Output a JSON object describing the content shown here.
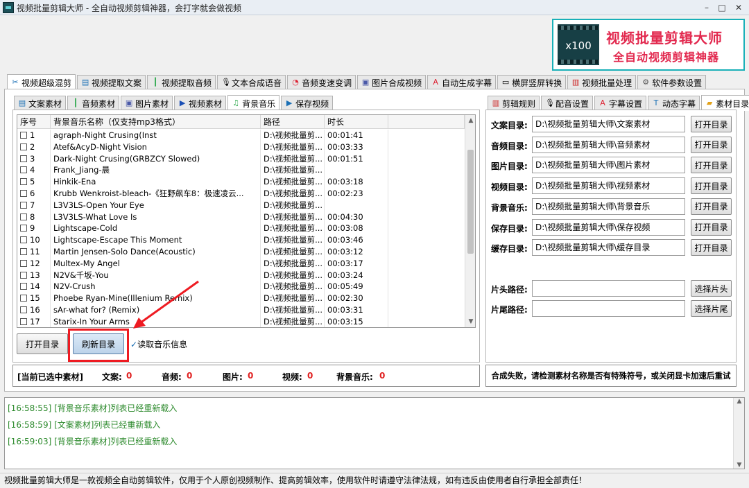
{
  "window": {
    "title": "视频批量剪辑大师 - 全自动视频剪辑神器，会打字就会做视频",
    "min": "–",
    "max": "□",
    "close": "✕"
  },
  "logo": {
    "badge": "x100",
    "title": "视频批量剪辑大师",
    "subtitle": "全自动视频剪辑神器"
  },
  "main_tabs": [
    {
      "label": "视频超级混剪",
      "icon": "scissors-icon"
    },
    {
      "label": "视频提取文案",
      "icon": "document-icon"
    },
    {
      "label": "视频提取音频",
      "icon": "waveform-icon"
    },
    {
      "label": "文本合成语音",
      "icon": "microphone-icon"
    },
    {
      "label": "音频变速变调",
      "icon": "gauge-icon"
    },
    {
      "label": "图片合成视频",
      "icon": "image-icon"
    },
    {
      "label": "自动生成字幕",
      "icon": "subtitle-icon"
    },
    {
      "label": "横屏竖屏转换",
      "icon": "rotate-screen-icon"
    },
    {
      "label": "视频批量处理",
      "icon": "film-icon"
    },
    {
      "label": "软件参数设置",
      "icon": "gear-icon"
    }
  ],
  "left_tabs": [
    {
      "label": "文案素材"
    },
    {
      "label": "音频素材"
    },
    {
      "label": "图片素材"
    },
    {
      "label": "视频素材"
    },
    {
      "label": "背景音乐"
    },
    {
      "label": "保存视频"
    }
  ],
  "right_tabs": [
    {
      "label": "剪辑规则"
    },
    {
      "label": "配音设置"
    },
    {
      "label": "字幕设置"
    },
    {
      "label": "动态字幕"
    },
    {
      "label": "素材目录"
    }
  ],
  "table": {
    "headers": [
      "序号",
      "背景音乐名称（仅支持mp3格式）",
      "路径",
      "时长"
    ],
    "rows": [
      {
        "no": "1",
        "name": "agraph-Night Crusing(Inst",
        "path": "D:\\视频批量剪...",
        "dur": "00:01:41"
      },
      {
        "no": "2",
        "name": "Atef&AcyD-Night Vision",
        "path": "D:\\视频批量剪...",
        "dur": "00:03:33"
      },
      {
        "no": "3",
        "name": "Dark-Night Crusing(GRBZCY Slowed)",
        "path": "D:\\视频批量剪...",
        "dur": "00:01:51"
      },
      {
        "no": "4",
        "name": "Frank_Jiang-晨",
        "path": "D:\\视频批量剪...",
        "dur": ""
      },
      {
        "no": "5",
        "name": "Hinkik-Ena",
        "path": "D:\\视频批量剪...",
        "dur": "00:03:18"
      },
      {
        "no": "6",
        "name": "Krubb Wenkroist-bleach-《狂野飙车8：极速凌云...",
        "path": "D:\\视频批量剪...",
        "dur": "00:02:23"
      },
      {
        "no": "7",
        "name": "L3V3LS-Open Your Eye",
        "path": "D:\\视频批量剪...",
        "dur": ""
      },
      {
        "no": "8",
        "name": "L3V3LS-What Love Is",
        "path": "D:\\视频批量剪...",
        "dur": "00:04:30"
      },
      {
        "no": "9",
        "name": "Lightscape-Cold",
        "path": "D:\\视频批量剪...",
        "dur": "00:03:08"
      },
      {
        "no": "10",
        "name": "Lightscape-Escape This Moment",
        "path": "D:\\视频批量剪...",
        "dur": "00:03:46"
      },
      {
        "no": "11",
        "name": "Martin Jensen-Solo Dance(Acoustic)",
        "path": "D:\\视频批量剪...",
        "dur": "00:03:12"
      },
      {
        "no": "12",
        "name": "Multex-My Angel",
        "path": "D:\\视频批量剪...",
        "dur": "00:03:17"
      },
      {
        "no": "13",
        "name": "N2V&千坂-You",
        "path": "D:\\视频批量剪...",
        "dur": "00:03:24"
      },
      {
        "no": "14",
        "name": "N2V-Crush",
        "path": "D:\\视频批量剪...",
        "dur": "00:05:49"
      },
      {
        "no": "15",
        "name": "Phoebe Ryan-Mine(Illenium Remix)",
        "path": "D:\\视频批量剪...",
        "dur": "00:02:30"
      },
      {
        "no": "16",
        "name": "sAr-what for? (Remix)",
        "path": "D:\\视频批量剪...",
        "dur": "00:03:31"
      },
      {
        "no": "17",
        "name": "Starix-In Your Arms",
        "path": "D:\\视频批量剪...",
        "dur": "00:03:15"
      }
    ]
  },
  "buttons": {
    "open_dir": "打开目录",
    "refresh_dir": "刷新目录",
    "read_info": "读取音乐信息",
    "read_info_check": "✓"
  },
  "selection": {
    "label": "[当前已选中素材]",
    "items": [
      {
        "label": "文案:",
        "value": "0"
      },
      {
        "label": "音频:",
        "value": "0"
      },
      {
        "label": "图片:",
        "value": "0"
      },
      {
        "label": "视频:",
        "value": "0"
      },
      {
        "label": "背景音乐:",
        "value": "0"
      }
    ]
  },
  "right_status": "合成失败，请检测素材名称是否有特殊符号，或关闭显卡加速后重试",
  "directories": [
    {
      "label": "文案目录:",
      "value": "D:\\视频批量剪辑大师\\文案素材",
      "button": "打开目录"
    },
    {
      "label": "音频目录:",
      "value": "D:\\视频批量剪辑大师\\音频素材",
      "button": "打开目录"
    },
    {
      "label": "图片目录:",
      "value": "D:\\视频批量剪辑大师\\图片素材",
      "button": "打开目录"
    },
    {
      "label": "视频目录:",
      "value": "D:\\视频批量剪辑大师\\视频素材",
      "button": "打开目录"
    },
    {
      "label": "背景音乐:",
      "value": "D:\\视频批量剪辑大师\\背景音乐",
      "button": "打开目录"
    },
    {
      "label": "保存目录:",
      "value": "D:\\视频批量剪辑大师\\保存视频",
      "button": "打开目录"
    },
    {
      "label": "缓存目录:",
      "value": "D:\\视频批量剪辑大师\\缓存目录",
      "button": "打开目录"
    }
  ],
  "clips": [
    {
      "label": "片头路径:",
      "value": "",
      "button": "选择片头"
    },
    {
      "label": "片尾路径:",
      "value": "",
      "button": "选择片尾"
    }
  ],
  "log": [
    "[16:58:55] [背景音乐素材]列表已经重新载入",
    "[16:58:59] [文案素材]列表已经重新载入",
    "[16:59:03] [背景音乐素材]列表已经重新载入"
  ],
  "footer": "视频批量剪辑大师是一款视频全自动剪辑软件，仅用于个人原创视频制作、提高剪辑效率，使用软件时请遵守法律法规，如有违反由使用者自行承担全部责任！",
  "colors": {
    "accent": "#19b0b8",
    "brand_red": "#e2284e",
    "highlight": "#ee1b22",
    "log_green": "#2e8b2e"
  }
}
